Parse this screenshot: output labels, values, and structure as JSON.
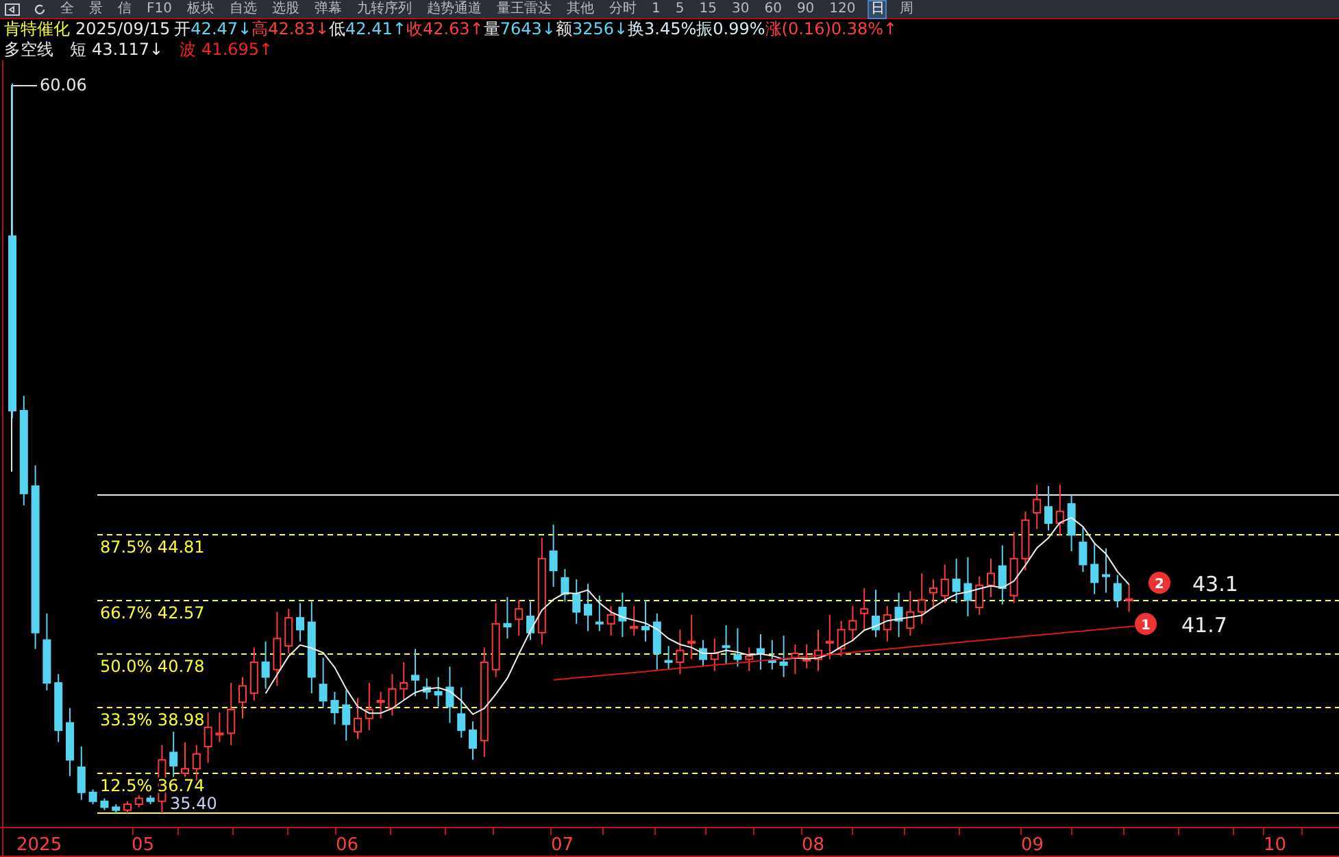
{
  "toolbar": {
    "items": [
      {
        "label": "全",
        "selected": false
      },
      {
        "label": "景",
        "selected": false
      },
      {
        "label": "信",
        "selected": false
      },
      {
        "label": "F10",
        "selected": false
      },
      {
        "label": "板块",
        "selected": false
      },
      {
        "label": "自选",
        "selected": false
      },
      {
        "label": "选股",
        "selected": false
      },
      {
        "label": "弹幕",
        "selected": false
      },
      {
        "label": "九转序列",
        "selected": false
      },
      {
        "label": "趋势通道",
        "selected": false
      },
      {
        "label": "量王雷达",
        "selected": false
      },
      {
        "label": "其他",
        "selected": false
      },
      {
        "label": "分时",
        "selected": false
      },
      {
        "label": "1",
        "selected": false
      },
      {
        "label": "5",
        "selected": false
      },
      {
        "label": "15",
        "selected": false
      },
      {
        "label": "30",
        "selected": false
      },
      {
        "label": "60",
        "selected": false
      },
      {
        "label": "90",
        "selected": false
      },
      {
        "label": "120",
        "selected": false
      },
      {
        "label": "日",
        "selected": true
      },
      {
        "label": "周",
        "selected": false
      }
    ]
  },
  "quote": {
    "name": "肯特催化",
    "date": "2025/09/15",
    "segments": [
      {
        "text": "开",
        "color": "#e8e8e8"
      },
      {
        "text": "42.47↓",
        "color": "#5fd7f5"
      },
      {
        "text": "高42.83↓",
        "color": "#ff4040"
      },
      {
        "text": "低",
        "color": "#e8e8e8"
      },
      {
        "text": "42.41↑",
        "color": "#5fd7f5"
      },
      {
        "text": "收42.63↑",
        "color": "#ff4040"
      },
      {
        "text": "量",
        "color": "#e8e8e8"
      },
      {
        "text": "7643↓",
        "color": "#5fd7f5"
      },
      {
        "text": "额",
        "color": "#e8e8e8"
      },
      {
        "text": "3256↓",
        "color": "#5fd7f5"
      },
      {
        "text": "换3.45%",
        "color": "#d8ecf8"
      },
      {
        "text": "振0.99%",
        "color": "#d8ecf8"
      },
      {
        "text": "涨(0.16)0.38%↑",
        "color": "#ff4040"
      }
    ]
  },
  "indicator": {
    "name": "多空线",
    "segments": [
      {
        "text": "短",
        "color": "#e8e8e8"
      },
      {
        "text": "43.117↓",
        "color": "#e8e8e8"
      },
      {
        "text": "波",
        "color": "#ff2020"
      },
      {
        "text": "41.695↑",
        "color": "#ff2020"
      }
    ]
  },
  "chart": {
    "high_label": "60.06",
    "low_label": "35.40",
    "levels": [
      {
        "label": "87.5% 44.81"
      },
      {
        "label": "66.7% 42.57"
      },
      {
        "label": "50.0% 40.78"
      },
      {
        "label": "33.3% 38.98"
      },
      {
        "label": "12.5% 36.74"
      }
    ],
    "markers": [
      {
        "number": "2",
        "value": "43.1"
      },
      {
        "number": "1",
        "value": "41.7"
      }
    ],
    "x_labels": [
      "2025",
      "05",
      "06",
      "07",
      "08",
      "09",
      "10"
    ]
  }
}
